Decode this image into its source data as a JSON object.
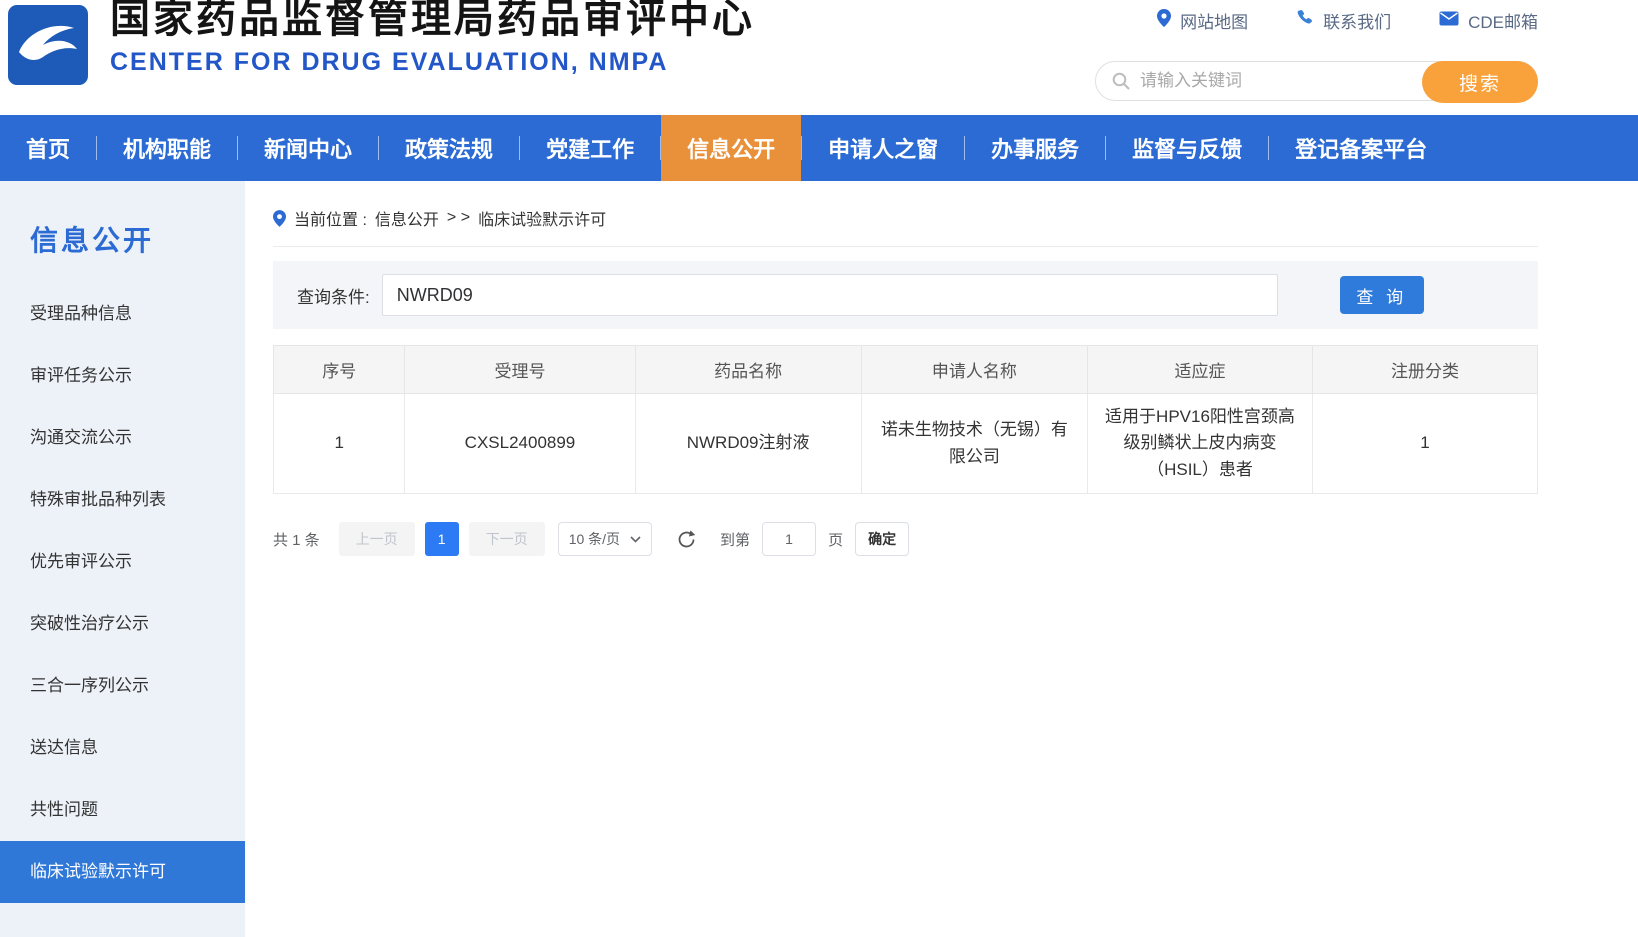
{
  "colors": {
    "nav_blue": "#2b6bd3",
    "nav_active_orange": "#e9913a",
    "search_button_orange": "#f9a13a",
    "subtitle_blue": "#2356c7",
    "sidebar_bg": "#edf1f8",
    "sidebar_active_blue": "#3078d7",
    "query_button_blue": "#2f7bdc",
    "pager_active_blue": "#2d7bf4"
  },
  "header": {
    "title": "国家药品监督管理局药品审评中心",
    "subtitle": "CENTER FOR DRUG EVALUATION, NMPA",
    "links": [
      {
        "label": "网站地图",
        "icon": "location-pin-icon"
      },
      {
        "label": "联系我们",
        "icon": "phone-icon"
      },
      {
        "label": "CDE邮箱",
        "icon": "mail-icon"
      }
    ],
    "search": {
      "placeholder": "请输入关键词",
      "button_label": "搜索"
    }
  },
  "nav": {
    "items": [
      {
        "label": "首页",
        "active": false
      },
      {
        "label": "机构职能",
        "active": false
      },
      {
        "label": "新闻中心",
        "active": false
      },
      {
        "label": "政策法规",
        "active": false
      },
      {
        "label": "党建工作",
        "active": false
      },
      {
        "label": "信息公开",
        "active": true
      },
      {
        "label": "申请人之窗",
        "active": false
      },
      {
        "label": "办事服务",
        "active": false
      },
      {
        "label": "监督与反馈",
        "active": false
      },
      {
        "label": "登记备案平台",
        "active": false
      }
    ]
  },
  "sidebar": {
    "title": "信息公开",
    "items": [
      {
        "label": "受理品种信息",
        "active": false
      },
      {
        "label": "审评任务公示",
        "active": false
      },
      {
        "label": "沟通交流公示",
        "active": false
      },
      {
        "label": "特殊审批品种列表",
        "active": false
      },
      {
        "label": "优先审评公示",
        "active": false
      },
      {
        "label": "突破性治疗公示",
        "active": false
      },
      {
        "label": "三合一序列公示",
        "active": false
      },
      {
        "label": "送达信息",
        "active": false
      },
      {
        "label": "共性问题",
        "active": false
      },
      {
        "label": "临床试验默示许可",
        "active": true
      }
    ]
  },
  "main": {
    "breadcrumb": {
      "prefix": "当前位置 :",
      "section": "信息公开",
      "separator": "> >",
      "current": "临床试验默示许可"
    },
    "query": {
      "label": "查询条件:",
      "value": "NWRD09",
      "button_label": "查 询"
    },
    "table": {
      "headers": [
        "序号",
        "受理号",
        "药品名称",
        "申请人名称",
        "适应症",
        "注册分类"
      ],
      "rows": [
        [
          "1",
          "CXSL2400899",
          "NWRD09注射液",
          "诺未生物技术（无锡）有限公司",
          "适用于HPV16阳性宫颈高级别鳞状上皮内病变（HSIL）患者",
          "1"
        ]
      ]
    },
    "pagination": {
      "total": "共 1 条",
      "prev_label": "上一页",
      "current_page": "1",
      "next_label": "下一页",
      "page_size": "10 条/页",
      "goto_label": "到第",
      "goto_value": "1",
      "page_word": "页",
      "confirm_label": "确定"
    }
  }
}
